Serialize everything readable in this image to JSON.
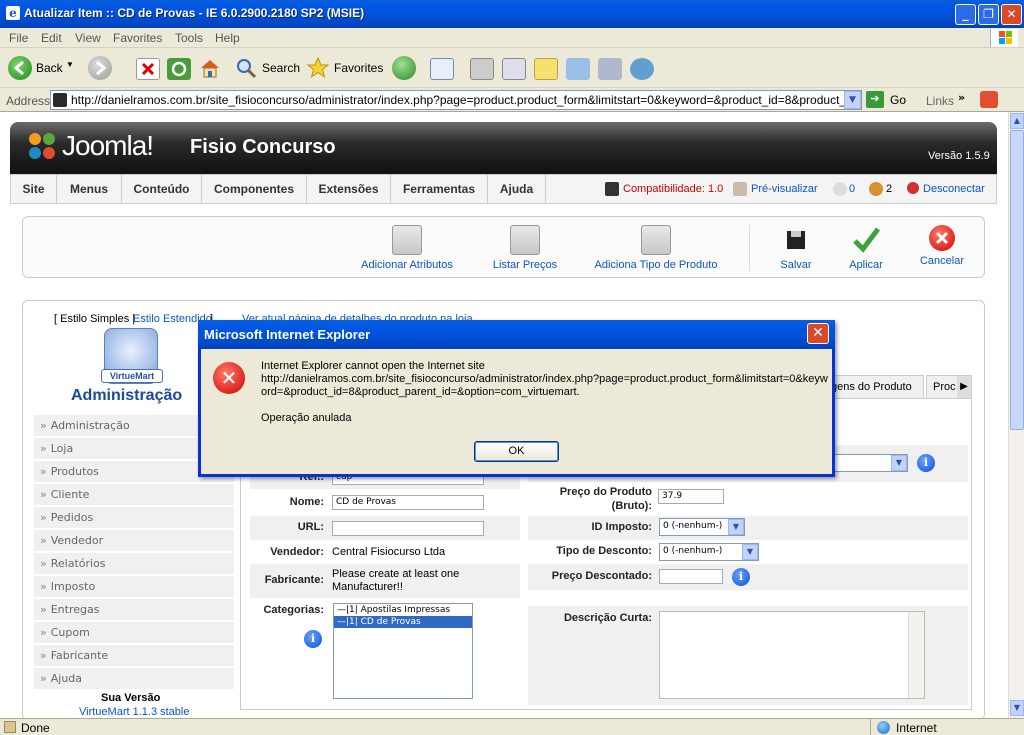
{
  "window": {
    "title": "Atualizar Item :: CD de Provas - IE 6.0.2900.2180 SP2 (MSIE)",
    "min": "_",
    "max": "❐",
    "close": "✕"
  },
  "menu": [
    "File",
    "Edit",
    "View",
    "Favorites",
    "Tools",
    "Help"
  ],
  "toolbar": {
    "back": "Back",
    "search": "Search",
    "favorites": "Favorites"
  },
  "address": {
    "label": "Address",
    "url": "http://danielramos.com.br/site_fisioconcurso/administrator/index.php?page=product.product_form&limitstart=0&keyword=&product_id=8&product_parent_id=",
    "go": "Go",
    "links": "Links"
  },
  "joomla": {
    "logo": "Joomla!",
    "site_name": "Fisio Concurso",
    "version": "Versão 1.5.9",
    "menu": [
      "Site",
      "Menus",
      "Conteúdo",
      "Componentes",
      "Extensões",
      "Ferramentas",
      "Ajuda"
    ],
    "compat": "Compatibilidade: 1.0",
    "preview": "Pré-visualizar",
    "messages_count": "0",
    "users_count": "2",
    "logout": "Desconectar",
    "actions": [
      "Adicionar Atributos",
      "Listar Preços",
      "Adiciona Tipo de Produto",
      "Salvar",
      "Aplicar",
      "Cancelar"
    ]
  },
  "sidebar": {
    "style_simple": "[ Estilo Simples |",
    "style_extended": "Estilo Estendido",
    "style_close": "]",
    "vm_logo": "VirtueMart",
    "admin_title": "Administração",
    "items": [
      "Administração",
      "Loja",
      "Produtos",
      "Cliente",
      "Pedidos",
      "Vendedor",
      "Relatórios",
      "Imposto",
      "Entregas",
      "Cupom",
      "Fabricante",
      "Ajuda"
    ],
    "version_label": "Sua Versão",
    "version_value": "VirtueMart 1.1.3 stable"
  },
  "link_top": "Ver atual página de detalhes do produto na loja",
  "tabs": [
    "gens do Produto",
    "Proc"
  ],
  "form": {
    "ref_label": "Ref.:",
    "ref_value": "cdp",
    "name_label": "Nome:",
    "name_value": "CD de Provas",
    "url_label": "URL:",
    "url_value": "",
    "vendor_label": "Vendedor:",
    "vendor_value": "Central Fisiocurso Ltda",
    "manufacturer_label": "Fabricante:",
    "manufacturer_value": "Please create at least one Manufacturer!!",
    "categories_label": "Categorias:",
    "categories": [
      "—|1| Apostilas Impressas",
      "—|1| CD de Provas"
    ],
    "price_label": "Preço do Produto (Bruto):",
    "price_value": "37.9",
    "tax_label": "ID Imposto:",
    "tax_value": "0 (-nenhum-)",
    "discount_type_label": "Tipo de Desconto:",
    "discount_type_value": "0 (-nenhum-)",
    "discounted_label": "Preço Descontado:",
    "discounted_value": "",
    "short_desc_label": "Descrição Curta:"
  },
  "dialog": {
    "title": "Microsoft Internet Explorer",
    "line1": "Internet Explorer cannot open the Internet site",
    "line2": "http://danielramos.com.br/site_fisioconcurso/administrator/index.php?page=product.product_form&limitstart=0&keyword=&product_id=8&product_parent_id=&option=com_virtuemart.",
    "line3": "Operação anulada",
    "ok": "OK"
  },
  "status": {
    "left": "Done",
    "zone": "Internet"
  }
}
